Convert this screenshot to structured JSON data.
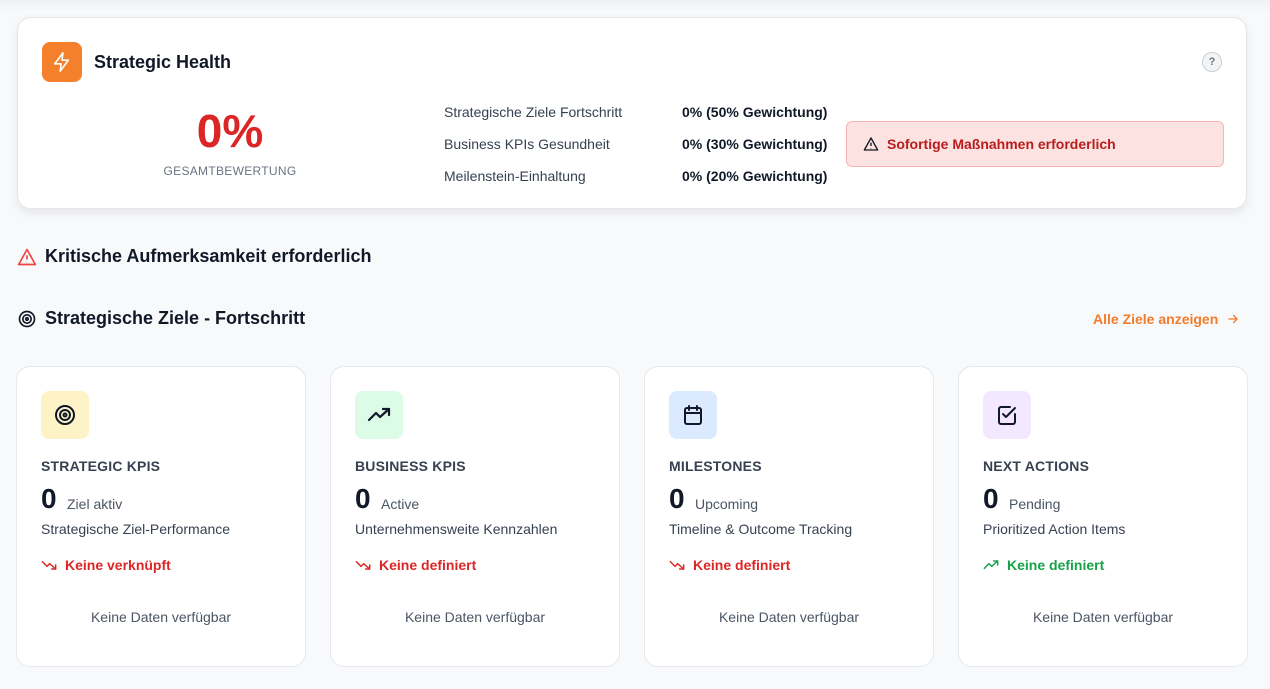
{
  "health": {
    "title": "Strategic Health",
    "help_label": "?",
    "score": "0%",
    "score_label": "GESAMTBEWERTUNG",
    "metrics": [
      {
        "label": "Strategische Ziele Fortschritt",
        "value": "0% (50% Gewichtung)"
      },
      {
        "label": "Business KPIs Gesundheit",
        "value": "0% (30% Gewichtung)"
      },
      {
        "label": "Meilenstein-Einhaltung",
        "value": "0% (20% Gewichtung)"
      }
    ],
    "alert": "Sofortige Maßnahmen erforderlich"
  },
  "critical": {
    "title": "Kritische Aufmerksamkeit erforderlich"
  },
  "goals": {
    "title": "Strategische Ziele - Fortschritt",
    "view_all": "Alle Ziele anzeigen"
  },
  "cards": [
    {
      "title": "STRATEGIC KPIS",
      "count": "0",
      "unit": "Ziel aktiv",
      "desc": "Strategische Ziel-Performance",
      "trend": "Keine verknüpft",
      "trend_dir": "down",
      "empty": "Keine Daten verfügbar",
      "icon": "target-icon",
      "icon_bg": "#fef3c7"
    },
    {
      "title": "BUSINESS KPIS",
      "count": "0",
      "unit": "Active",
      "desc": "Unternehmensweite Kennzahlen",
      "trend": "Keine definiert",
      "trend_dir": "down",
      "empty": "Keine Daten verfügbar",
      "icon": "trending-up-icon",
      "icon_bg": "#dcfce7"
    },
    {
      "title": "MILESTONES",
      "count": "0",
      "unit": "Upcoming",
      "desc": "Timeline & Outcome Tracking",
      "trend": "Keine definiert",
      "trend_dir": "down",
      "empty": "Keine Daten verfügbar",
      "icon": "calendar-icon",
      "icon_bg": "#dbeafe"
    },
    {
      "title": "NEXT ACTIONS",
      "count": "0",
      "unit": "Pending",
      "desc": "Prioritized Action Items",
      "trend": "Keine definiert",
      "trend_dir": "up",
      "empty": "Keine Daten verfügbar",
      "icon": "checkbox-icon",
      "icon_bg": "#f3e8ff"
    }
  ],
  "colors": {
    "accent": "#f5802b",
    "danger": "#dc2626",
    "success": "#16a34a"
  }
}
